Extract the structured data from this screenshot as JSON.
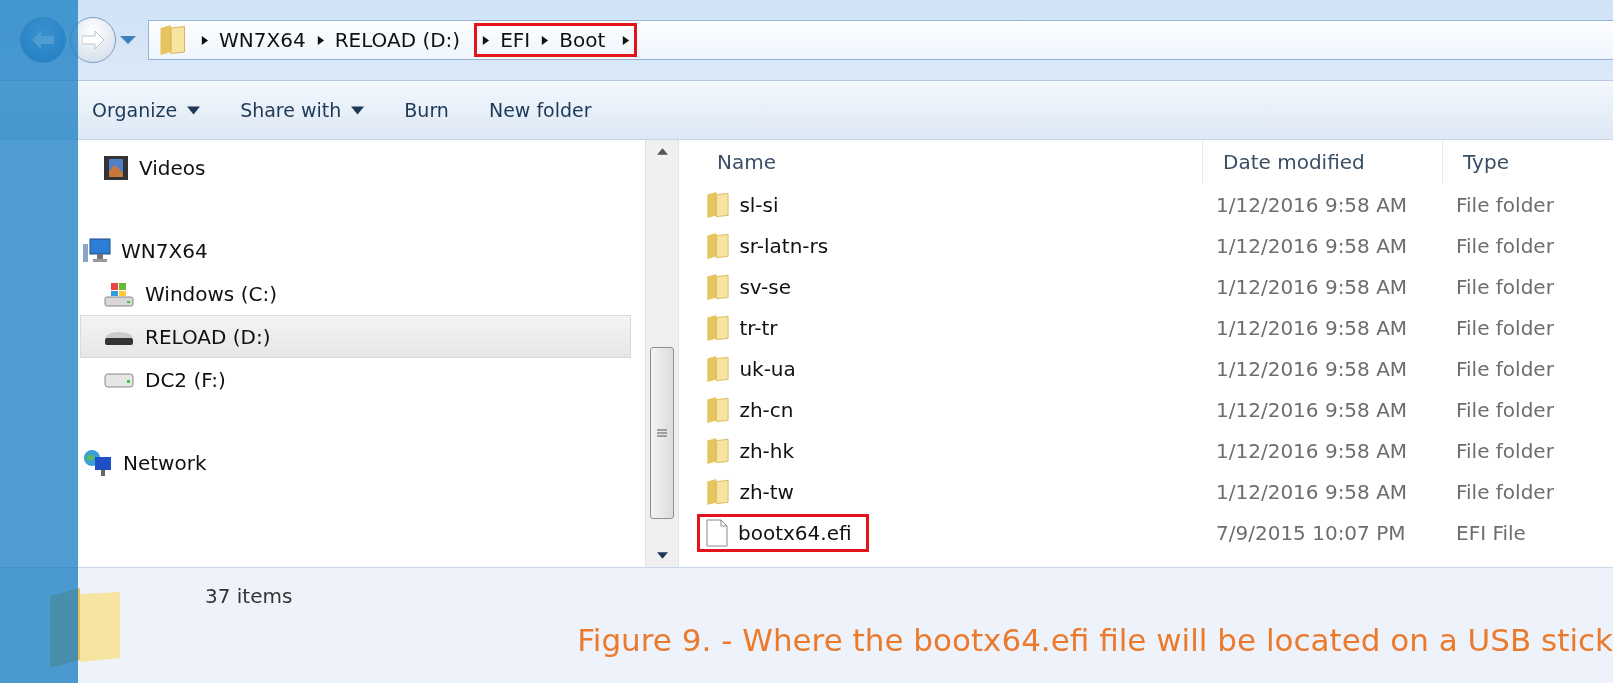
{
  "address_bar": {
    "crumbs": [
      "WN7X64",
      "RELOAD (D:)"
    ],
    "highlighted_crumbs": [
      "EFI",
      "Boot"
    ]
  },
  "toolbar": {
    "buttons": [
      {
        "label": "Organize",
        "dropdown": true
      },
      {
        "label": "Share with",
        "dropdown": true
      },
      {
        "label": "Burn",
        "dropdown": false
      },
      {
        "label": "New folder",
        "dropdown": false
      }
    ]
  },
  "navigation": {
    "sections": [
      {
        "children": [
          {
            "label": "Videos",
            "kind": "videos",
            "selected": false
          }
        ]
      },
      {
        "label": "WN7X64",
        "kind": "computer",
        "selected": false,
        "children": [
          {
            "label": "Windows (C:)",
            "kind": "system-drive",
            "selected": false
          },
          {
            "label": "RELOAD (D:)",
            "kind": "removable-drive",
            "selected": true
          },
          {
            "label": "DC2 (F:)",
            "kind": "drive",
            "selected": false
          }
        ]
      },
      {
        "label": "Network",
        "kind": "network",
        "selected": false
      }
    ]
  },
  "file_list": {
    "columns": [
      "Name",
      "Date modified",
      "Type"
    ],
    "rows": [
      {
        "name": "sl-si",
        "date": "1/12/2016 9:58 AM",
        "type": "File folder",
        "kind": "folder",
        "highlighted": false
      },
      {
        "name": "sr-latn-rs",
        "date": "1/12/2016 9:58 AM",
        "type": "File folder",
        "kind": "folder",
        "highlighted": false
      },
      {
        "name": "sv-se",
        "date": "1/12/2016 9:58 AM",
        "type": "File folder",
        "kind": "folder",
        "highlighted": false
      },
      {
        "name": "tr-tr",
        "date": "1/12/2016 9:58 AM",
        "type": "File folder",
        "kind": "folder",
        "highlighted": false
      },
      {
        "name": "uk-ua",
        "date": "1/12/2016 9:58 AM",
        "type": "File folder",
        "kind": "folder",
        "highlighted": false
      },
      {
        "name": "zh-cn",
        "date": "1/12/2016 9:58 AM",
        "type": "File folder",
        "kind": "folder",
        "highlighted": false
      },
      {
        "name": "zh-hk",
        "date": "1/12/2016 9:58 AM",
        "type": "File folder",
        "kind": "folder",
        "highlighted": false
      },
      {
        "name": "zh-tw",
        "date": "1/12/2016 9:58 AM",
        "type": "File folder",
        "kind": "folder",
        "highlighted": false
      },
      {
        "name": "bootx64.efi",
        "date": "7/9/2015 10:07 PM",
        "type": "EFI File",
        "kind": "file",
        "highlighted": true
      }
    ]
  },
  "status_bar": {
    "item_count": "37 items"
  },
  "caption": "Figure 9. - Where the bootx64.efi file will be located on a USB stick"
}
